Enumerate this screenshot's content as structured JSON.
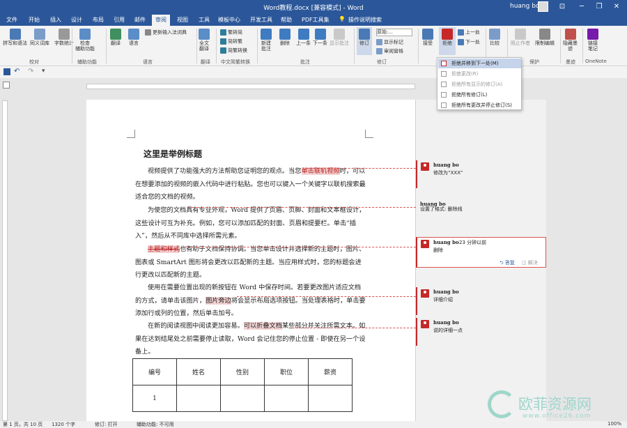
{
  "titlebar": {
    "title": "Word教程.docx [兼容模式] - Word",
    "user": "huang bo",
    "min": "─",
    "restore": "❐",
    "close": "✕",
    "ribbon_display": "⊡"
  },
  "tabs": [
    "文件",
    "开始",
    "插入",
    "设计",
    "布局",
    "引用",
    "邮件",
    "审阅",
    "视图",
    "工具",
    "模板中心",
    "开发工具",
    "帮助",
    "PDF工具集",
    "操作说明搜索"
  ],
  "active_tab": "审阅",
  "ribbon": {
    "groups": {
      "proofing": "校对",
      "accessibility": "辅助功能",
      "language": "语言",
      "translation": "翻译",
      "chinese": "中文简繁转换",
      "comments": "批注",
      "tracking": "修订",
      "protect": "保护",
      "ink": "墨迹",
      "onenote": "OneNote"
    },
    "buttons": {
      "spell": "拼写和语法",
      "thesaurus": "同义词库",
      "wordcount": "字数统计",
      "check_access_1": "检查",
      "check_access_2": "辅助功能",
      "translate": "翻译",
      "language": "语言",
      "update_ime": "更新输入法词典",
      "full_translate_1": "全文",
      "full_translate_2": "翻译",
      "to_trad": "繁转简",
      "to_simp": "简转繁",
      "conv": "简繁转换",
      "new_comment_1": "新建",
      "new_comment_2": "批注",
      "delete": "删除",
      "prev": "上一条",
      "next": "下一条",
      "show_comments": "显示批注",
      "track": "修订",
      "markup_mode": "原始:...",
      "show_markup": "显示标记",
      "review_pane": "审阅窗格",
      "accept": "接受",
      "reject": "拒绝",
      "prev_change": "上一处",
      "next_change": "下一处",
      "compare": "比较",
      "block_authors": "阻止作者",
      "restrict": "限制编辑",
      "hide_ink_1": "隐藏墨",
      "hide_ink_2": "迹",
      "link_notes_1": "链接",
      "link_notes_2": "笔记"
    }
  },
  "dropdown": {
    "items": [
      {
        "label": "拒绝并移到下一处(M)",
        "hover": true,
        "disabled": false
      },
      {
        "label": "拒绝更改(R)",
        "hover": false,
        "disabled": true
      },
      {
        "label": "拒绝所有显示的修订(A)",
        "hover": false,
        "disabled": true
      },
      {
        "label": "拒绝所有修订(L)",
        "hover": false,
        "disabled": false
      },
      {
        "label": "拒绝所有更改并停止修订(S)",
        "hover": false,
        "disabled": false
      }
    ]
  },
  "document": {
    "title": "这里是举例标题",
    "p1": {
      "a": "视频提供了功能强大的方法帮助您证明您的观点。当您",
      "ins": "单击联机视频",
      "b": "时，可以在想要添加的视频的嵌入代码中进行粘贴。您也可以键入一个关键字以联机搜索最适合您的文档的视频。"
    },
    "p2": "为使您的文档具有专业外观，Word 提供了页眉、页脚、封面和文本框设计，这些设计可互为补充。例如，您可以添加匹配的封面、页眉和提要栏。单击“插入”，然后从不同库中选择所需元素。",
    "p3": {
      "del": "主题和样式",
      "b": "也有助于文档保持协调。当您单击设计并选择新的主题时，图片、图表或 SmartArt 图形将会更改以匹配新的主题。当应用样式时，您的标题会进行更改以匹配新的主题。"
    },
    "p4": {
      "a": "使用在需要位置出现的新按钮在 Word 中保存时间。若要更改图片适应文档的方式，请单击该图片，",
      "hl": "图片旁边",
      "b": "将会显示布局选项按钮。当处理表格时，单击要添加行或列的位置，然后单击加号。"
    },
    "p5": {
      "a": "在新的阅读视图中阅读更加容易。",
      "hl": "可以折叠文档",
      "b": "某些部分并关注所需文本。如果在达到结尾处之前需要停止读取，Word 会记住您的停止位置 - 即使在另一个设备上。"
    },
    "table": {
      "headers": [
        "编号",
        "姓名",
        "性别",
        "职位",
        "薪资"
      ],
      "rows": [
        [
          "1",
          "",
          "",
          "",
          ""
        ]
      ]
    }
  },
  "comments": [
    {
      "author": "huang bo",
      "text": "修改为“XXX”"
    },
    {
      "author": "huang bo",
      "text": "设置了格式: 删除线",
      "bold_label": "设置了格式:"
    },
    {
      "author": "huang bo",
      "time": "23 分钟以前",
      "text": "删除",
      "reply": "答复",
      "resolve": "解决"
    },
    {
      "author": "huang bo",
      "text": "详细介绍"
    },
    {
      "author": "huang bo",
      "text": "说的详细一点"
    }
  ],
  "status": {
    "page": "第 1 页，共 10 页",
    "words": "1320 个字",
    "track": "修订: 打开",
    "access": "辅助功能: 不可用",
    "zoom": "100%"
  },
  "watermark": {
    "brand": "欧菲资源网",
    "url": "www.office26.com"
  },
  "colors": {
    "brand": "#2b579a",
    "revision": "#b71c1c",
    "highlight": "#f3d3d3"
  }
}
